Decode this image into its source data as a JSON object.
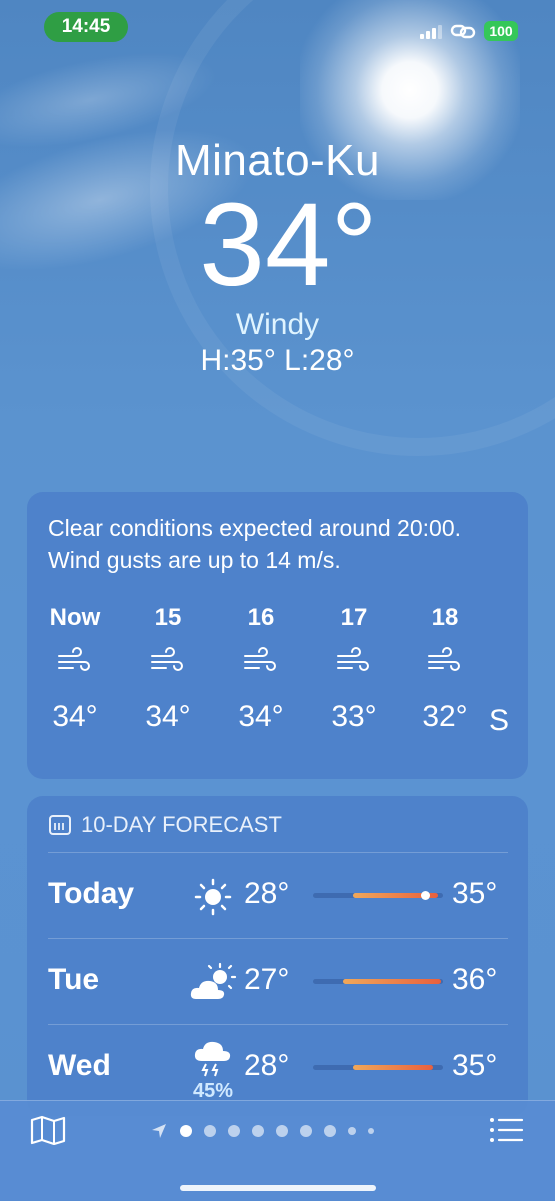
{
  "status": {
    "time": "14:45",
    "battery": "100"
  },
  "location": {
    "city": "Minato-Ku",
    "temperature": "34°",
    "condition": "Windy",
    "high_low": "H:35°  L:28°"
  },
  "summary_card": {
    "text": "Clear conditions expected around 20:00. Wind gusts are up to 14 m/s.",
    "hours": [
      {
        "label": "Now",
        "icon": "wind-icon",
        "temp": "34°"
      },
      {
        "label": "15",
        "icon": "wind-icon",
        "temp": "34°"
      },
      {
        "label": "16",
        "icon": "wind-icon",
        "temp": "34°"
      },
      {
        "label": "17",
        "icon": "wind-icon",
        "temp": "33°"
      },
      {
        "label": "18",
        "icon": "wind-icon",
        "temp": "32°"
      },
      {
        "label": "",
        "icon": "",
        "temp": "S"
      }
    ]
  },
  "forecast": {
    "title": "10-DAY FORECAST",
    "days": [
      {
        "day": "Today",
        "icon": "sun-icon",
        "low": "28°",
        "high": "35°",
        "precip": ""
      },
      {
        "day": "Tue",
        "icon": "partly-cloudy-icon",
        "low": "27°",
        "high": "36°",
        "precip": ""
      },
      {
        "day": "Wed",
        "icon": "thunderstorm-icon",
        "low": "28°",
        "high": "35°",
        "precip": "45%"
      }
    ]
  },
  "colors": {
    "accent_bar": "#e8603e",
    "time_pill": "#2f9e44",
    "battery": "#35c759"
  }
}
